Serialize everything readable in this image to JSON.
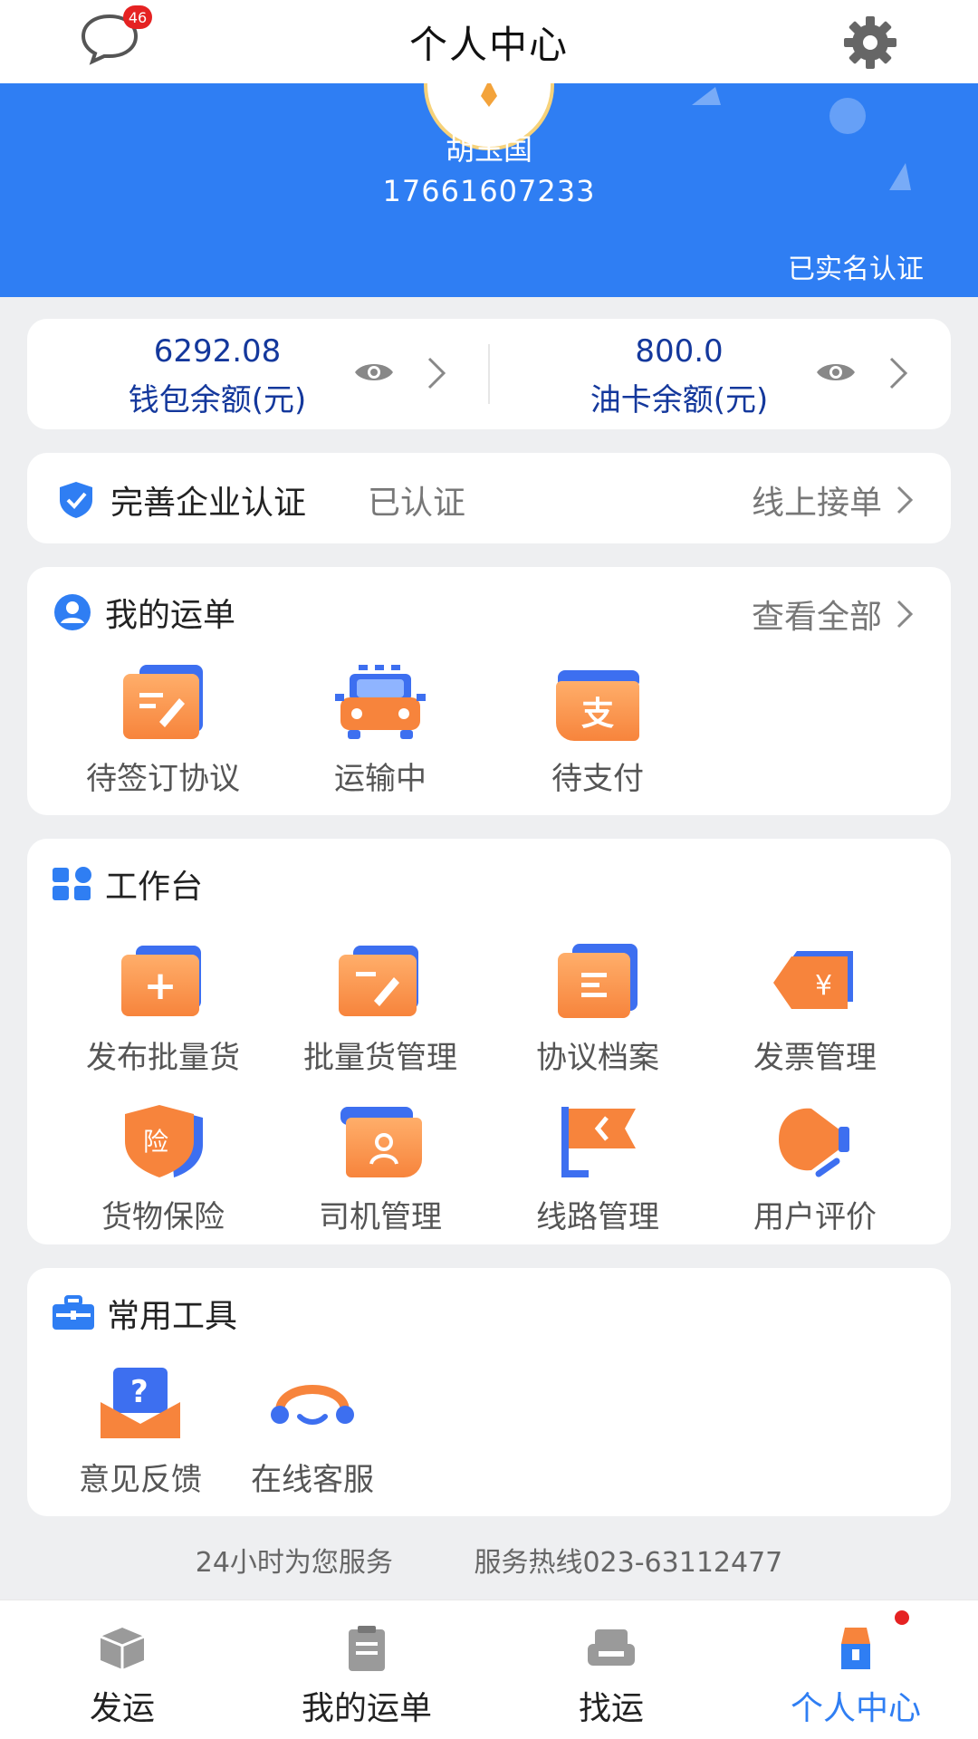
{
  "header": {
    "title": "个人中心",
    "message_badge": "46"
  },
  "profile": {
    "name": "胡玉国",
    "phone": "17661607233",
    "verified_label": "已实名认证"
  },
  "balances": {
    "wallet": {
      "amount": "6292.08",
      "label": "钱包余额(元)"
    },
    "fuel": {
      "amount": "800.0",
      "label": "油卡余额(元)"
    }
  },
  "certification": {
    "title": "完善企业认证",
    "status": "已认证",
    "link": "线上接单"
  },
  "orders": {
    "title": "我的运单",
    "view_all": "查看全部",
    "items": [
      {
        "label": "待签订协议",
        "icon": "pen-document-icon"
      },
      {
        "label": "运输中",
        "icon": "truck-icon"
      },
      {
        "label": "待支付",
        "icon": "payment-icon"
      }
    ]
  },
  "workbench": {
    "title": "工作台",
    "items": [
      {
        "label": "发布批量货",
        "icon": "publish-plus-icon"
      },
      {
        "label": "批量货管理",
        "icon": "pen-document-icon"
      },
      {
        "label": "协议档案",
        "icon": "document-list-icon"
      },
      {
        "label": "发票管理",
        "icon": "invoice-tag-icon"
      },
      {
        "label": "货物保险",
        "icon": "insurance-shield-icon"
      },
      {
        "label": "司机管理",
        "icon": "driver-folder-icon"
      },
      {
        "label": "线路管理",
        "icon": "route-flag-icon"
      },
      {
        "label": "用户评价",
        "icon": "megaphone-icon"
      }
    ]
  },
  "tools": {
    "title": "常用工具",
    "items": [
      {
        "label": "意见反馈",
        "icon": "feedback-question-icon"
      },
      {
        "label": "在线客服",
        "icon": "headset-icon"
      }
    ]
  },
  "footer": {
    "service_hours": "24小时为您服务",
    "hotline": "服务热线023-63112477"
  },
  "bottom_nav": [
    {
      "label": "发运",
      "icon": "package-icon",
      "active": false
    },
    {
      "label": "我的运单",
      "icon": "clipboard-icon",
      "active": false
    },
    {
      "label": "找运",
      "icon": "truck-front-icon",
      "active": false
    },
    {
      "label": "个人中心",
      "icon": "person-icon",
      "active": true
    }
  ],
  "colors": {
    "brand_blue": "#2f7ef3",
    "balance_text": "#14389c",
    "icon_orange": "#f7843c",
    "badge_red": "#e52222"
  }
}
